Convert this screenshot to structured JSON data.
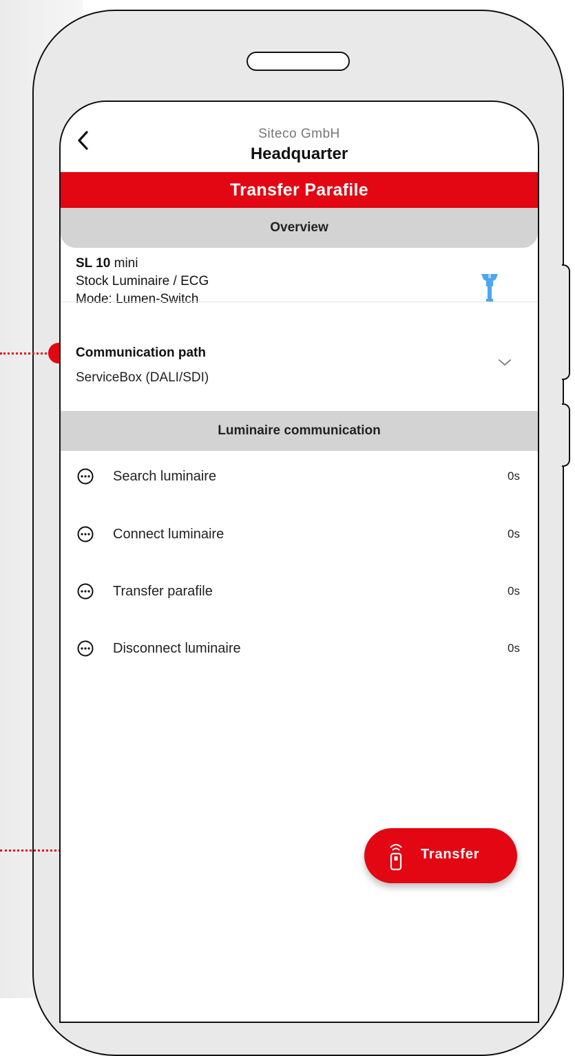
{
  "header": {
    "company": "Siteco GmbH",
    "location": "Headquarter"
  },
  "banner": {
    "title": "Transfer Parafile"
  },
  "overview": {
    "label": "Overview"
  },
  "product": {
    "name_bold": "SL 10",
    "name_rest": " mini",
    "type": "Stock Luminaire / ECG",
    "mode": "Mode: Lumen-Switch"
  },
  "communication": {
    "label": "Communication path",
    "value": "ServiceBox (DALI/SDI)"
  },
  "luminaire_section": {
    "label": "Luminaire communication"
  },
  "steps": [
    {
      "label": "Search luminaire",
      "time": "0s"
    },
    {
      "label": "Connect luminaire",
      "time": "0s"
    },
    {
      "label": "Transfer parafile",
      "time": "0s"
    },
    {
      "label": "Disconnect luminaire",
      "time": "0s"
    }
  ],
  "action": {
    "transfer_label": "Transfer"
  },
  "colors": {
    "accent": "#e30613",
    "lamp": "#4da6f0",
    "section_bg": "#d3d3d3"
  },
  "icons": {
    "back": "chevron-left-icon",
    "lamp": "street-lamp-icon",
    "expand": "chevron-down-icon",
    "step_pending": "ellipsis-circle-icon",
    "transfer": "remote-signal-icon"
  }
}
